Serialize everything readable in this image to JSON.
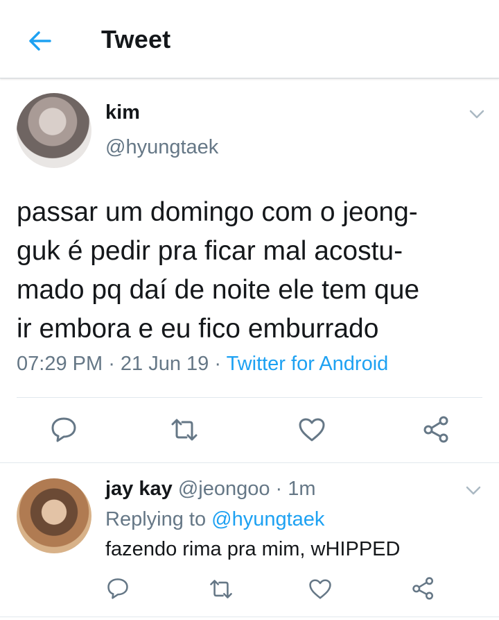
{
  "header": {
    "title": "Tweet",
    "back_icon": "arrow-left-icon"
  },
  "tweet": {
    "name": "kim",
    "handle": "@hyungtaek",
    "text": "passar um domingo com o jeong-\nguk é pedir pra ficar mal acostu-\nmado pq daí de noite ele tem que\nir embora e eu fico emburrado",
    "time": "07:29 PM",
    "sep1": " · ",
    "date": "21 Jun 19",
    "sep2": " · ",
    "source": "Twitter for Android",
    "actions": [
      "reply-icon",
      "retweet-icon",
      "like-icon",
      "share-icon"
    ]
  },
  "reply": {
    "name": "jay kay",
    "handle": "@jeongoo",
    "sep": " · ",
    "time": "1m",
    "replying_prefix": "Replying to ",
    "replying_to": "@hyungtaek",
    "text": "fazendo rima pra mim, wHIPPED",
    "actions": [
      "reply-icon",
      "retweet-icon",
      "like-icon",
      "share-icon"
    ]
  },
  "colors": {
    "accent": "#1da1f2",
    "secondary_text": "#657786",
    "icon": "#657786",
    "divider": "#e1e8ed"
  }
}
